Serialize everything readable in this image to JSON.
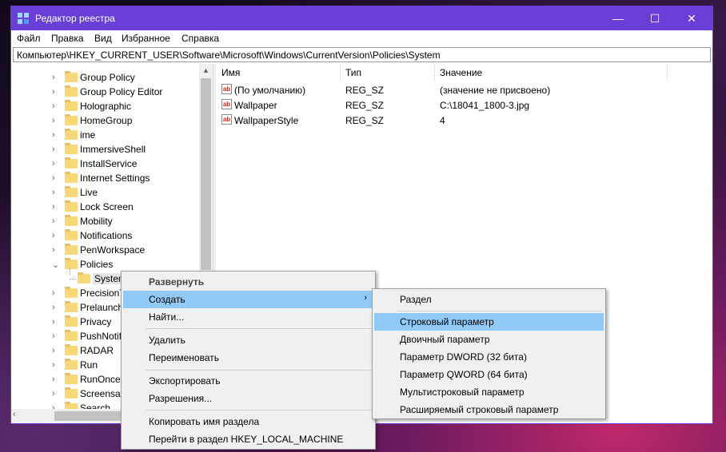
{
  "window": {
    "title": "Редактор реестра",
    "controls": {
      "minimize": "—",
      "maximize": "☐",
      "close": "✕"
    }
  },
  "menu": [
    "Файл",
    "Правка",
    "Вид",
    "Избранное",
    "Справка"
  ],
  "address": "Компьютер\\HKEY_CURRENT_USER\\Software\\Microsoft\\Windows\\CurrentVersion\\Policies\\System",
  "tree": {
    "items": [
      {
        "label": "Group Policy",
        "expanded": false
      },
      {
        "label": "Group Policy Editor",
        "expanded": false
      },
      {
        "label": "Holographic",
        "expanded": false
      },
      {
        "label": "HomeGroup",
        "expanded": false
      },
      {
        "label": "ime",
        "expanded": false
      },
      {
        "label": "ImmersiveShell",
        "expanded": false
      },
      {
        "label": "InstallService",
        "expanded": false
      },
      {
        "label": "Internet Settings",
        "expanded": false
      },
      {
        "label": "Live",
        "expanded": false
      },
      {
        "label": "Lock Screen",
        "expanded": false
      },
      {
        "label": "Mobility",
        "expanded": false
      },
      {
        "label": "Notifications",
        "expanded": false
      },
      {
        "label": "PenWorkspace",
        "expanded": false
      },
      {
        "label": "Policies",
        "expanded": true
      },
      {
        "label": "System",
        "child": true,
        "selected": true
      },
      {
        "label": "PrecisionT",
        "expanded": false
      },
      {
        "label": "Prelaunch",
        "expanded": false
      },
      {
        "label": "Privacy",
        "expanded": false
      },
      {
        "label": "PushNotif",
        "expanded": false
      },
      {
        "label": "RADAR",
        "expanded": false
      },
      {
        "label": "Run",
        "expanded": false
      },
      {
        "label": "RunOnce",
        "expanded": false
      },
      {
        "label": "Screensav",
        "expanded": false
      },
      {
        "label": "Search",
        "expanded": false
      }
    ]
  },
  "values": {
    "columns": [
      "Имя",
      "Тип",
      "Значение"
    ],
    "rows": [
      {
        "name": "(По умолчанию)",
        "type": "REG_SZ",
        "data": "(значение не присвоено)"
      },
      {
        "name": "Wallpaper",
        "type": "REG_SZ",
        "data": "C:\\18041_1800-3.jpg"
      },
      {
        "name": "WallpaperStyle",
        "type": "REG_SZ",
        "data": "4"
      }
    ]
  },
  "context_menu": {
    "expand": "Развернуть",
    "create": "Создать",
    "find": "Найти...",
    "delete": "Удалить",
    "rename": "Переименовать",
    "export": "Экспортировать",
    "permissions": "Разрешения...",
    "copy_key_name": "Копировать имя раздела",
    "goto_hklm": "Перейти в раздел HKEY_LOCAL_MACHINE",
    "submenu_arrow": "›"
  },
  "submenu": {
    "key": "Раздел",
    "string_value": "Строковый параметр",
    "binary_value": "Двоичный параметр",
    "dword_value": "Параметр DWORD (32 бита)",
    "qword_value": "Параметр QWORD (64 бита)",
    "multi_string_value": "Мультистроковый параметр",
    "expandable_string_value": "Расширяемый строковый параметр"
  },
  "ab_icon_text": "ab",
  "colors": {
    "titlebar": "#6a3fd8",
    "highlight": "#91c9f7",
    "folder": "#f8d877"
  }
}
